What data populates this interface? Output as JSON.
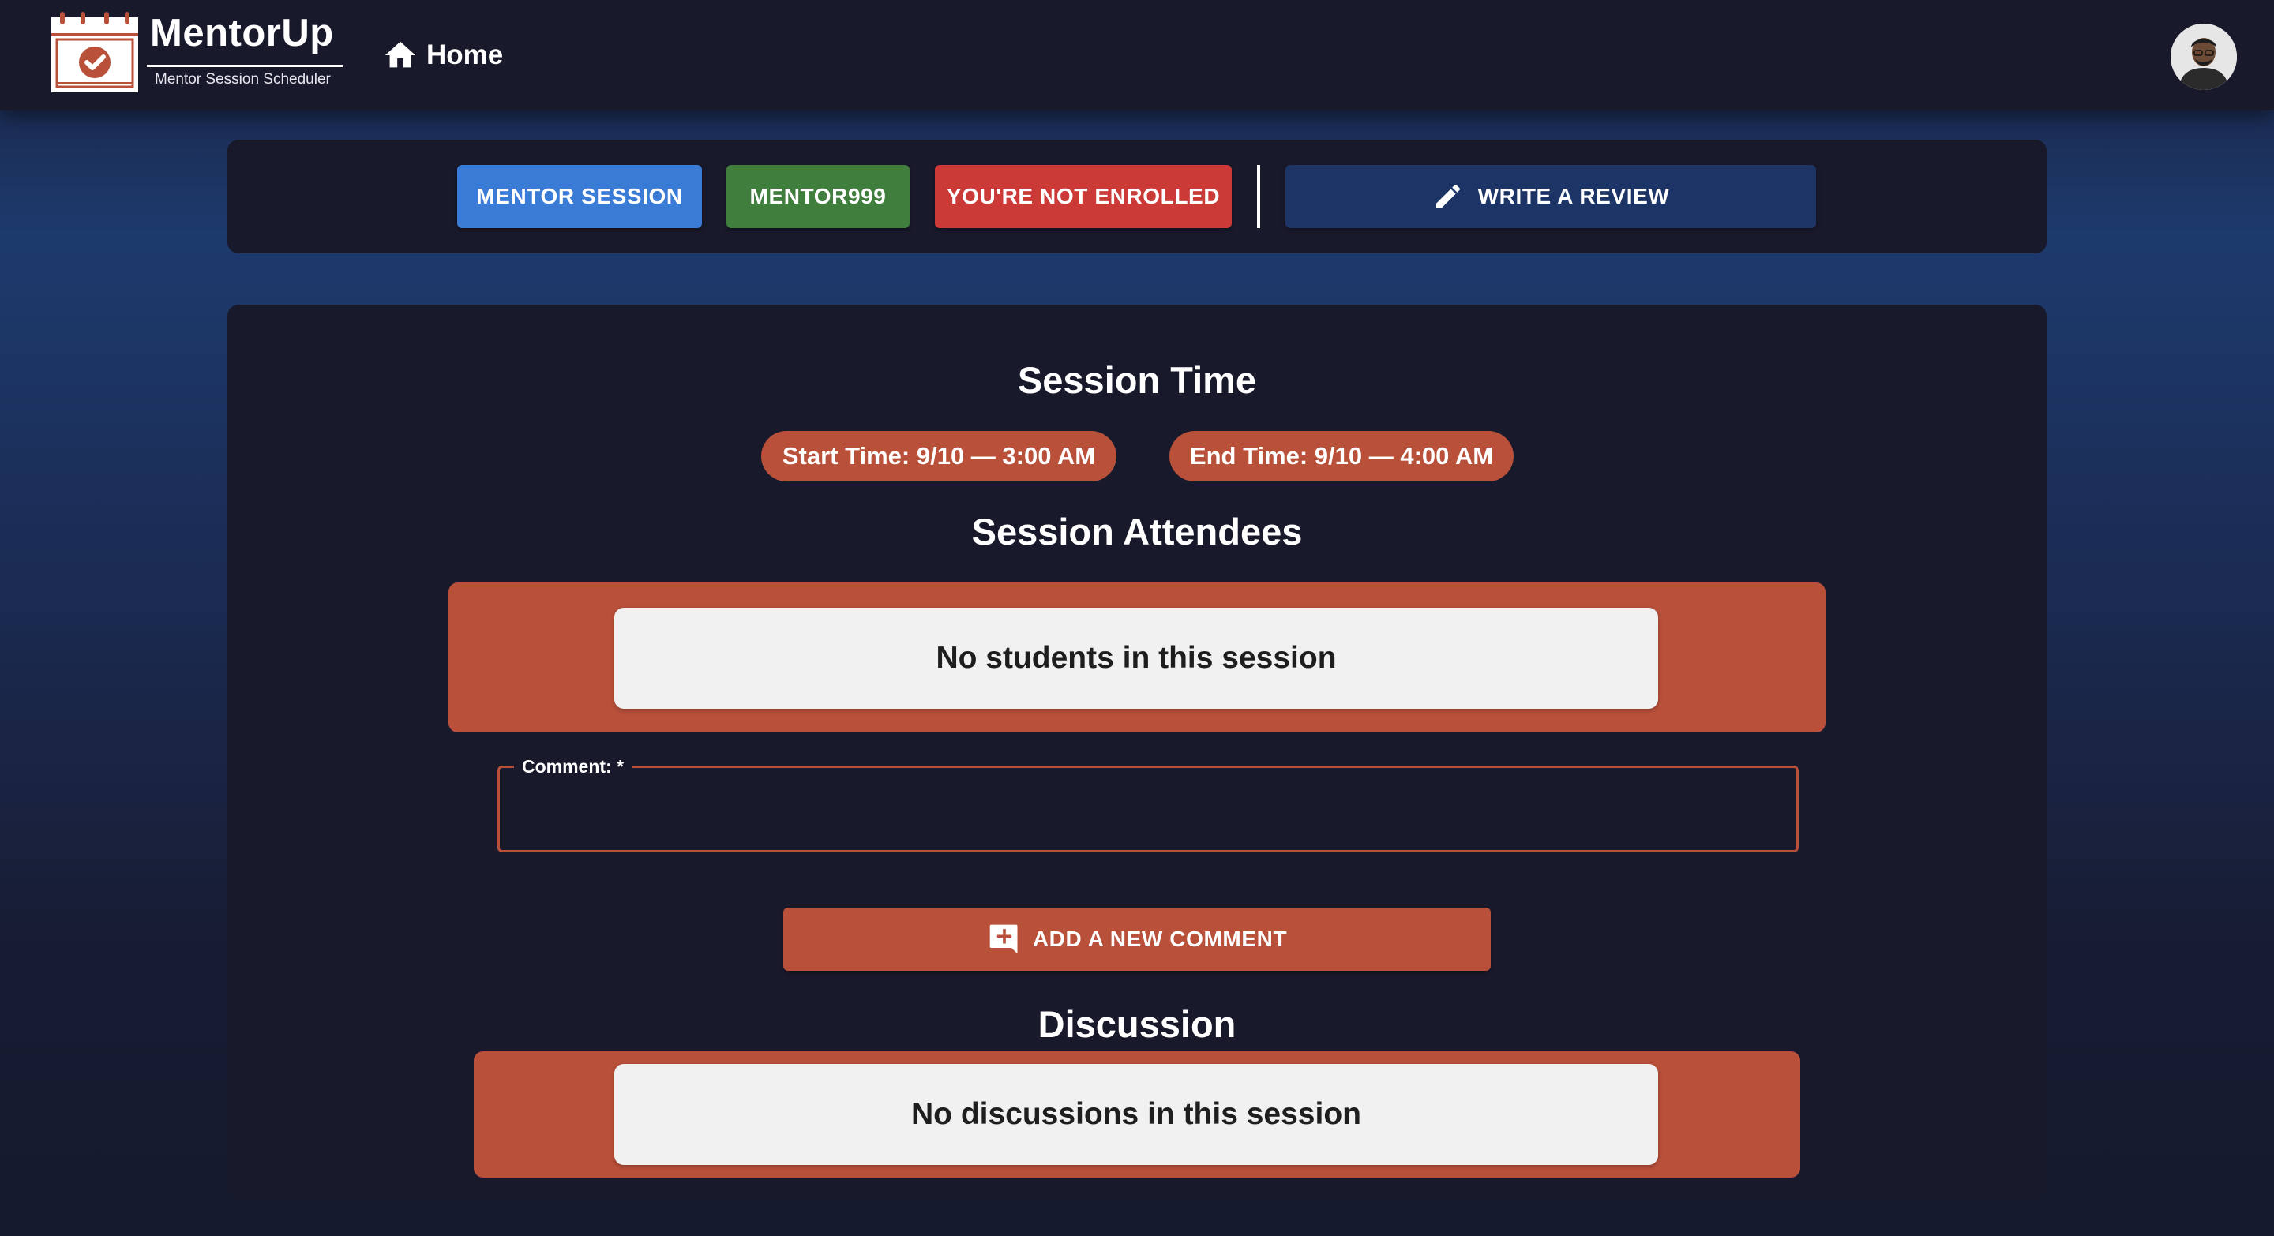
{
  "navbar": {
    "brand_name": "MentorUp",
    "brand_tagline": "Mentor Session Scheduler",
    "logo_icon": "calendar-check-icon",
    "home_label": "Home",
    "home_icon": "home-icon",
    "avatar_icon": "user-avatar"
  },
  "action_bar": {
    "mentor_session_label": "MENTOR SESSION",
    "mentor_id_label": "MENTOR999",
    "enrollment_status_label": "YOU'RE NOT ENROLLED",
    "write_review_label": "WRITE A REVIEW",
    "write_review_icon": "pencil-icon"
  },
  "session": {
    "time_title": "Session Time",
    "start_time": "Start Time: 9/10 — 3:00 AM",
    "end_time": "End Time: 9/10 — 4:00 AM",
    "attendees_title": "Session Attendees",
    "attendees_empty": "No students in this session",
    "comment_label": "Comment: *",
    "comment_value": "",
    "add_comment_label": "ADD A NEW COMMENT",
    "add_comment_icon": "add-comment-icon",
    "discussion_title": "Discussion",
    "discussion_empty": "No discussions in this session"
  },
  "colors": {
    "navbar_bg": "#19192c",
    "accent_orange": "#b9503a",
    "mentor_session_blue": "#3a7bd5",
    "mentor_id_green": "#3f7e3c",
    "not_enrolled_red": "#cc3a38",
    "review_navy": "#1c3566",
    "empty_card_bg": "#f1f1f1"
  }
}
